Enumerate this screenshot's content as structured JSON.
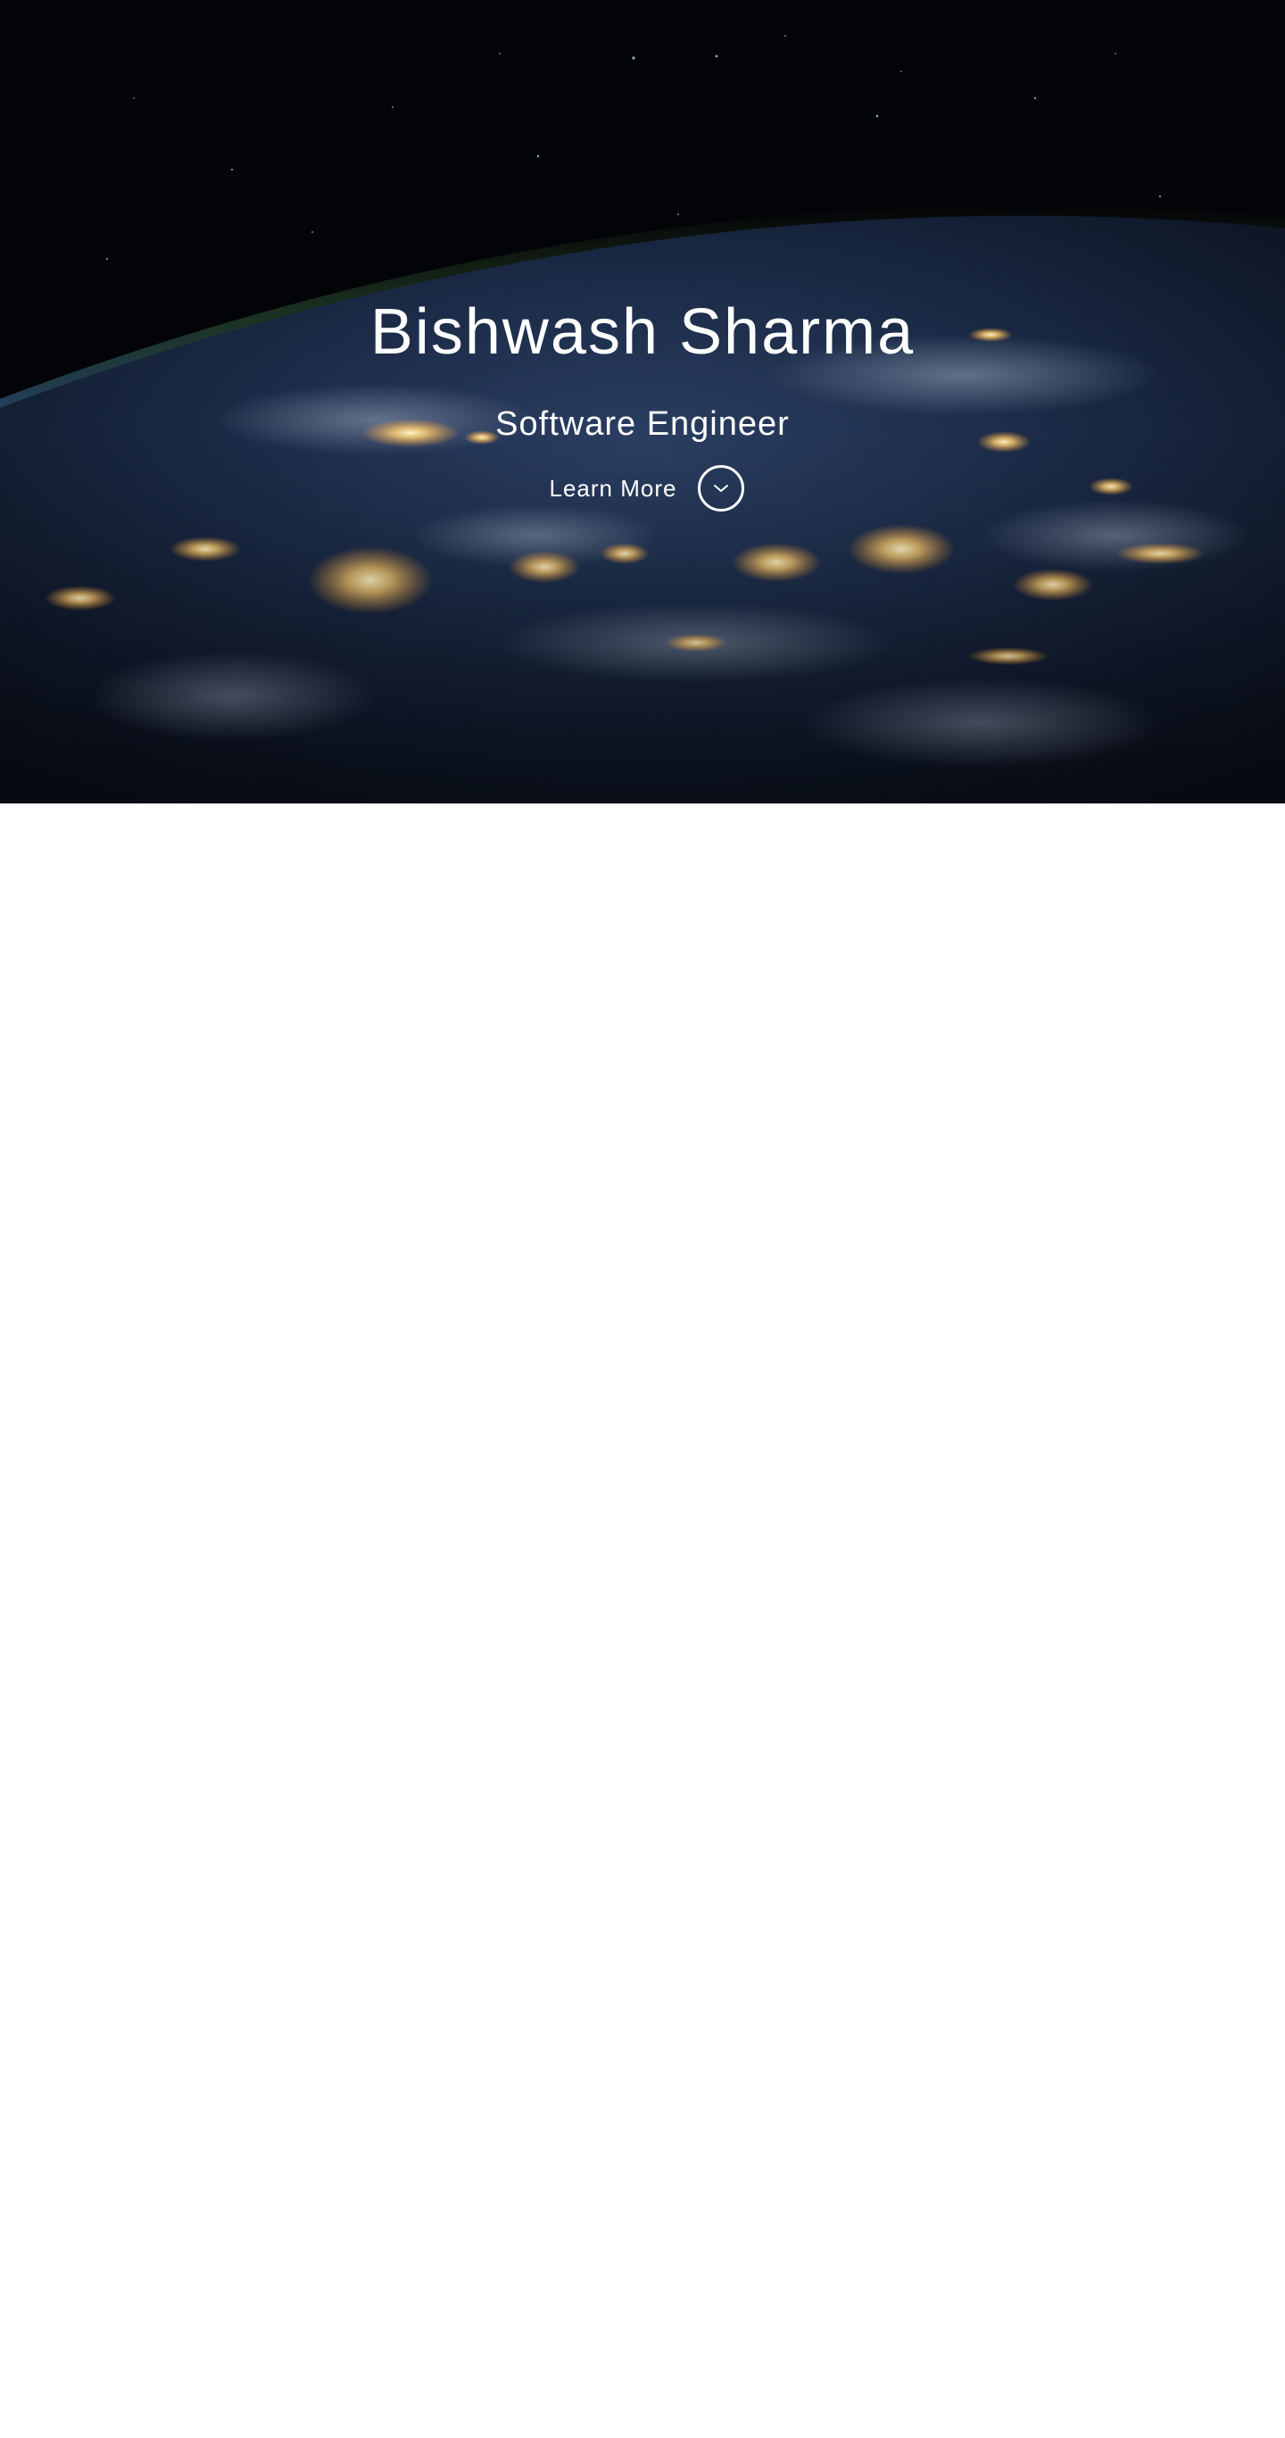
{
  "hero": {
    "title": "Bishwash Sharma",
    "subtitle": "Software Engineer",
    "learn_more_label": "Learn More",
    "learn_more_icon": "chevron-down-icon",
    "background": "earth-at-night-from-space-photo"
  },
  "colors": {
    "text": "#ffffff",
    "page_background": "#ffffff",
    "space": "#030407",
    "ocean": "#1b2a45",
    "city_lights": "#ffd68a"
  }
}
